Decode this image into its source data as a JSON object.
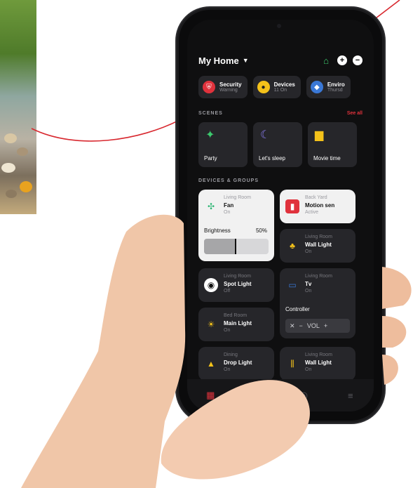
{
  "header": {
    "title": "My Home"
  },
  "quick_chips": [
    {
      "title": "Security",
      "subtitle": "Warning",
      "icon": "shield-icon",
      "color": "#e0323c"
    },
    {
      "title": "Devices",
      "subtitle": "11 On",
      "icon": "bulb-icon",
      "color": "#f4c21a"
    },
    {
      "title": "Enviro",
      "subtitle": "Thursd",
      "icon": "environment-icon",
      "color": "#3a78d6"
    }
  ],
  "scenes": {
    "label": "SCENES",
    "see_all": "See all",
    "items": [
      {
        "label": "Party",
        "icon": "party-icon",
        "color": "#3cc96d"
      },
      {
        "label": "Let's sleep",
        "icon": "moon-icon",
        "color": "#8a7cf0"
      },
      {
        "label": "Movie time",
        "icon": "clapper-icon",
        "color": "#f4c21a"
      }
    ]
  },
  "devices": {
    "label": "DEVICES & GROUPS",
    "fan": {
      "room": "Living Room",
      "name": "Fan",
      "status": "On",
      "brightness_label": "Brightness",
      "brightness_value": "50%",
      "brightness_fraction": 0.5
    },
    "motion": {
      "room": "Back Yard",
      "name": "Motion sen",
      "status": "Active"
    },
    "wall_light_1": {
      "room": "Living Room",
      "name": "Wall Light",
      "status": "On"
    },
    "spot_light": {
      "room": "Living Room",
      "name": "Spot Light",
      "status": "Off"
    },
    "tv": {
      "room": "Living Room",
      "name": "Tv",
      "status": "On",
      "controller_label": "Controller",
      "vol_label": "VOL"
    },
    "main_light": {
      "room": "Bed Room",
      "name": "Main Light",
      "status": "On"
    },
    "drop_light": {
      "room": "Dining",
      "name": "Drop Light",
      "status": "On"
    },
    "wall_light_2": {
      "room": "Living Room",
      "name": "Wall Light",
      "status": "On"
    }
  },
  "accent": "#e0323c"
}
